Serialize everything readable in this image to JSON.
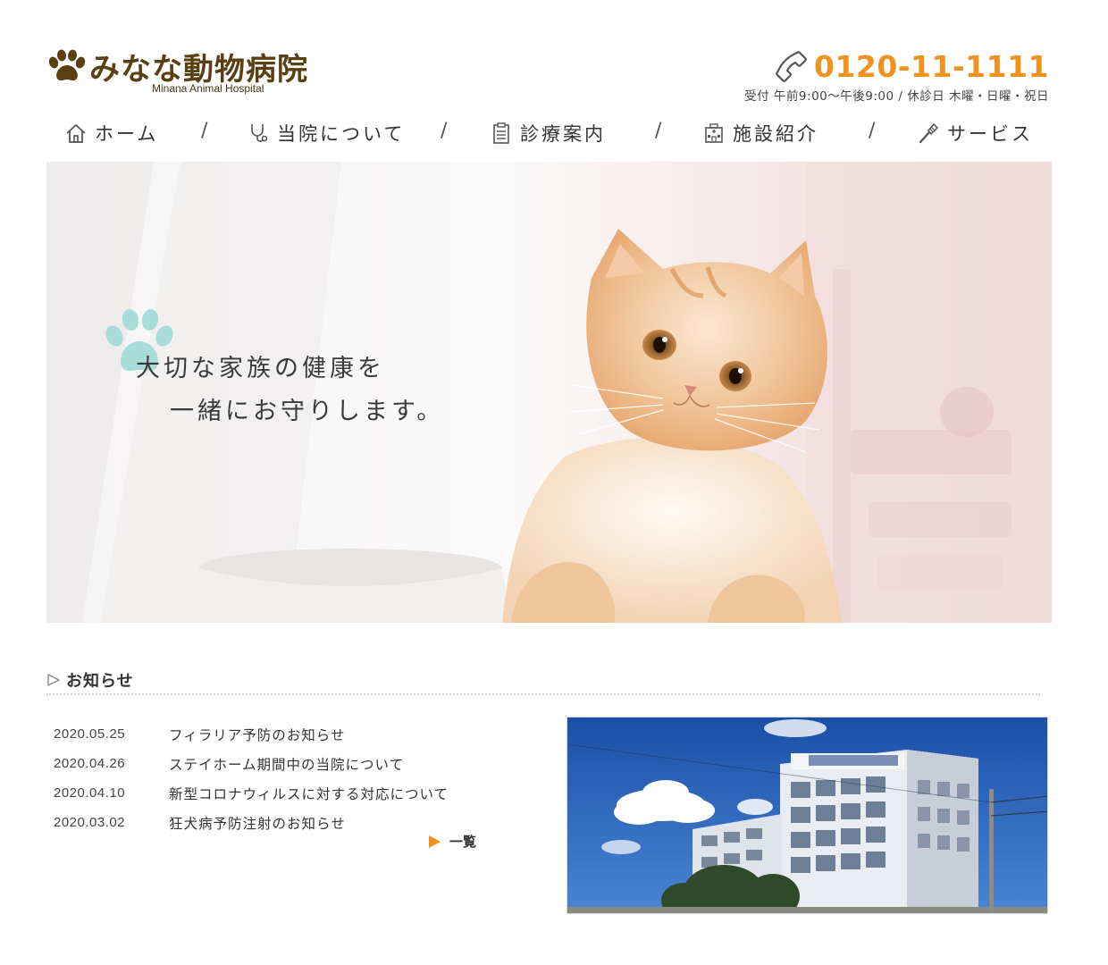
{
  "header": {
    "logo_name": "みなな動物病院",
    "logo_sub": "Minana Animal Hospital",
    "phone": "0120-11-1111",
    "hours": "受付 午前9:00～午後9:00 / 休診日 木曜・日曜・祝日"
  },
  "nav": {
    "items": [
      {
        "label": "ホーム",
        "icon": "home-icon"
      },
      {
        "label": "当院について",
        "icon": "stethoscope-icon"
      },
      {
        "label": "診療案内",
        "icon": "clipboard-icon"
      },
      {
        "label": "施設紹介",
        "icon": "building-icon"
      },
      {
        "label": "サービス",
        "icon": "brush-icon"
      }
    ],
    "separator": "/"
  },
  "hero": {
    "line1": "大切な家族の健康を",
    "line2": "一緒にお守りします。"
  },
  "news": {
    "title": "お知らせ",
    "items": [
      {
        "date": "2020.05.25",
        "text": "フィラリア予防のお知らせ"
      },
      {
        "date": "2020.04.26",
        "text": "ステイホーム期間中の当院について"
      },
      {
        "date": "2020.04.10",
        "text": "新型コロナウィルスに対する対応について"
      },
      {
        "date": "2020.03.02",
        "text": "狂犬病予防注射のお知らせ"
      }
    ],
    "more": "一覧"
  },
  "colors": {
    "accent": "#f0921e",
    "logo": "#5a3f12",
    "paw_deco": "#a8dcd9"
  }
}
